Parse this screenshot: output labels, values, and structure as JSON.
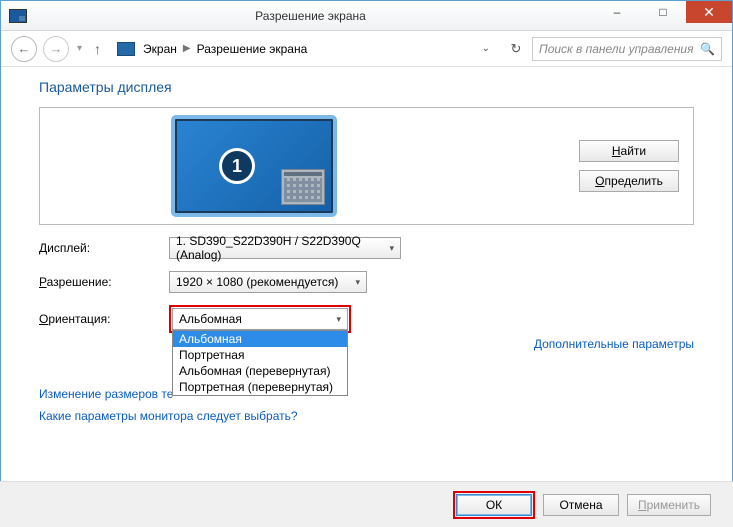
{
  "window": {
    "title": "Разрешение экрана",
    "minimize": "–",
    "maximize": "□",
    "close": "✕"
  },
  "toolbar": {
    "breadcrumb_root": "Экран",
    "breadcrumb_current": "Разрешение экрана",
    "search_placeholder": "Поиск в панели управления"
  },
  "heading": "Параметры дисплея",
  "buttons": {
    "find": "Найти",
    "identify": "Определить",
    "ok": "ОК",
    "cancel": "Отмена",
    "apply": "Применить"
  },
  "monitor": {
    "number": "1"
  },
  "form": {
    "display_label": "Дисплей:",
    "display_value": "1. SD390_S22D390H / S22D390Q (Analog)",
    "resolution_label": "Разрешение:",
    "resolution_value": "1920 × 1080 (рекомендуется)",
    "orientation_label": "Ориентация:",
    "orientation_value": "Альбомная",
    "orientation_options": {
      "o1": "Альбомная",
      "o2": "Портретная",
      "o3": "Альбомная (перевернутая)",
      "o4": "Портретная (перевернутая)"
    }
  },
  "links": {
    "advanced": "Дополнительные параметры",
    "resize_text": "Изменение размеров те",
    "which_monitor": "Какие параметры монитора следует выбрать?"
  }
}
